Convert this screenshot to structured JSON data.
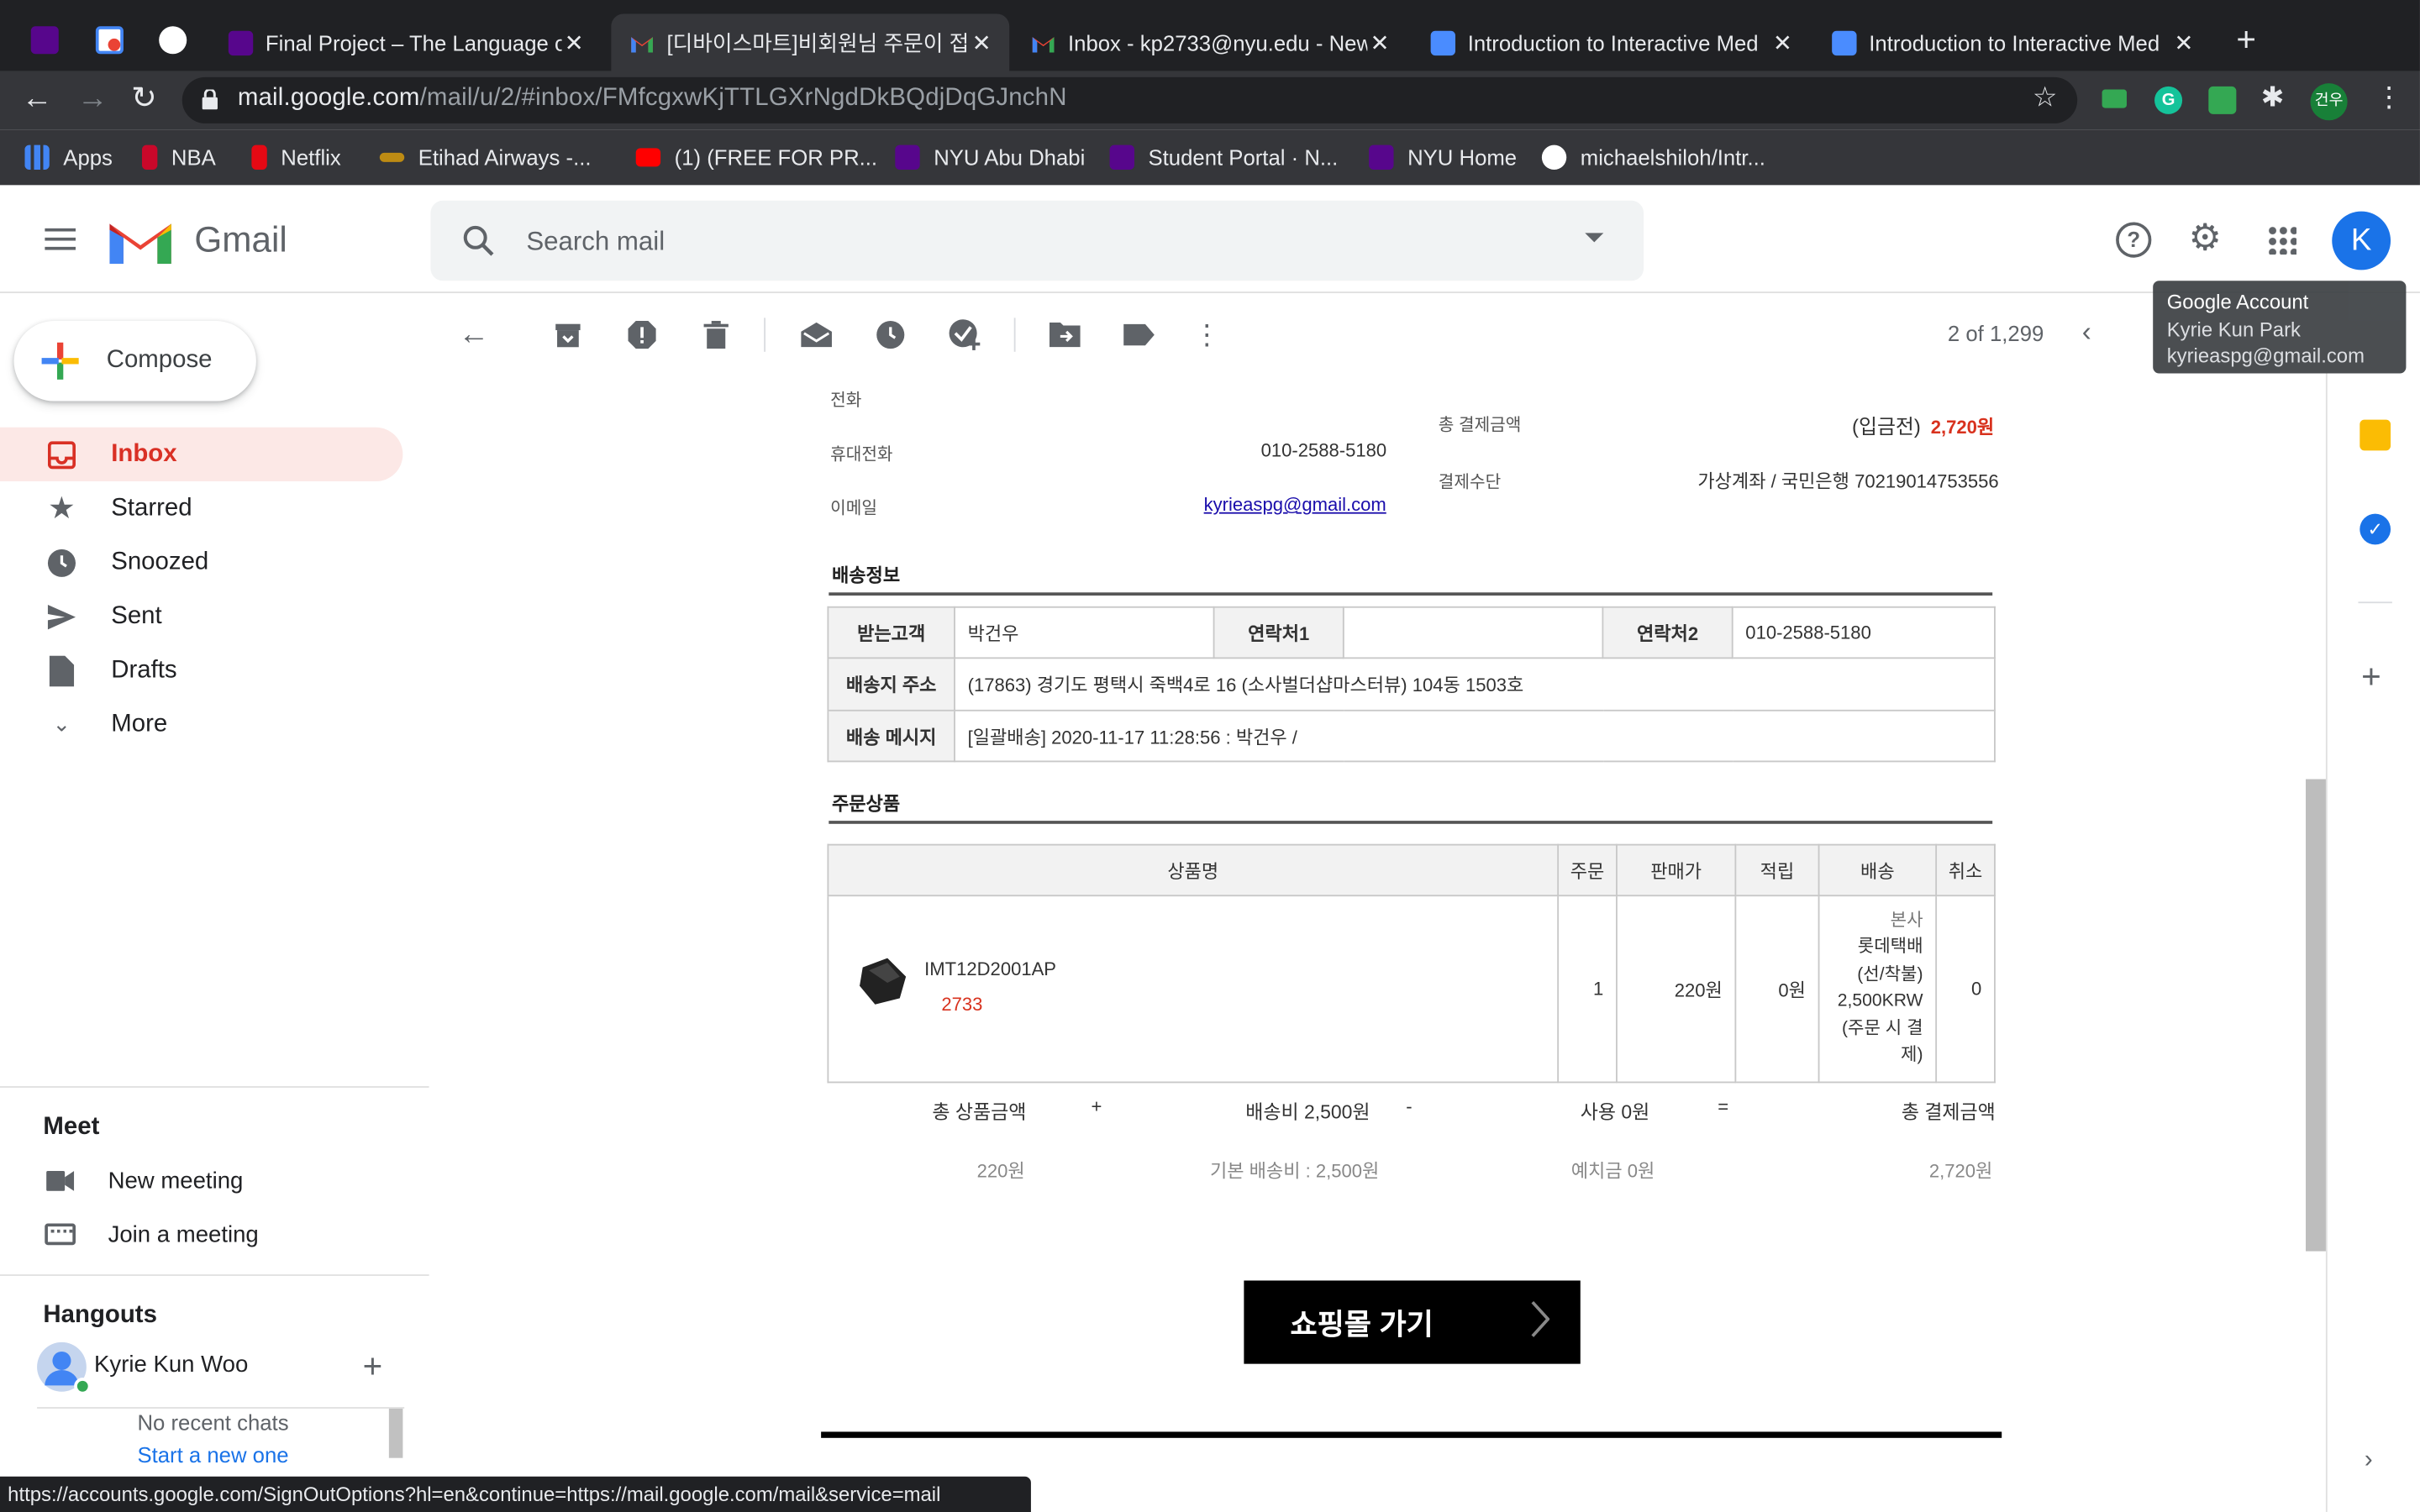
{
  "browser": {
    "tabs": [
      {
        "title": "Final Project – The Language o",
        "active": false
      },
      {
        "title": "[디바이스마트]비회원님 주문이 접수",
        "active": true
      },
      {
        "title": "Inbox - kp2733@nyu.edu - New",
        "active": false
      },
      {
        "title": "Introduction to Interactive Med",
        "active": false
      },
      {
        "title": "Introduction to Interactive Med",
        "active": false
      }
    ],
    "url_host": "mail.google.com",
    "url_path": "/mail/u/2/#inbox/FMfcgxwKjTTLGXrNgdDkBQdjDqGJnchN",
    "profile_badge": "건우",
    "bookmarks": [
      "Apps",
      "NBA",
      "Netflix",
      "Etihad Airways -...",
      "(1) (FREE FOR PR...",
      "NYU Abu Dhabi",
      "Student Portal · N...",
      "NYU Home",
      "michaelshiloh/Intr..."
    ]
  },
  "gmail": {
    "logo_text": "Gmail",
    "search_placeholder": "Search mail",
    "avatar_letter": "K",
    "compose": "Compose",
    "nav": [
      "Inbox",
      "Starred",
      "Snoozed",
      "Sent",
      "Drafts",
      "More"
    ],
    "meet_title": "Meet",
    "meet_items": [
      "New meeting",
      "Join a meeting"
    ],
    "hangouts_title": "Hangouts",
    "hangouts_user": "Kyrie Kun Woo",
    "no_chats": "No recent chats",
    "start_new": "Start a new one",
    "pagination": "2 of 1,299",
    "tooltip": {
      "title": "Google Account",
      "name": "Kyrie Kun Park",
      "email": "kyrieaspg@gmail.com"
    },
    "status_url": "https://accounts.google.com/SignOutOptions?hl=en&continue=https://mail.google.com/mail&service=mail"
  },
  "email": {
    "phone_label": "전화",
    "mobile_label": "휴대전화",
    "mobile_value": "010-2588-5180",
    "email_label": "이메일",
    "email_value": "kyrieaspg@gmail.com",
    "total_label": "총 결제금액",
    "total_prefix": "(입금전)",
    "total_value": "2,720원",
    "payment_label": "결제수단",
    "payment_value": "가상계좌 / 국민은행 70219014753556",
    "shipping_title": "배송정보",
    "receiver_label": "받는고객",
    "receiver_value": "박건우",
    "contact1_label": "연락처1",
    "contact1_value": "",
    "contact2_label": "연락처2",
    "contact2_value": "010-2588-5180",
    "address_label": "배송지 주소",
    "address_value": "(17863) 경기도 평택시 죽백4로 16 (소사벌더샵마스터뷰) 104동 1503호",
    "message_label": "배송 메시지",
    "message_value": "[일괄배송] 2020-11-17 11:28:56 : 박건우 /",
    "order_title": "주문상품",
    "cols": [
      "상품명",
      "주문",
      "판매가",
      "적립",
      "배송",
      "취소"
    ],
    "product": {
      "name": "IMT12D2001AP",
      "option": "2733",
      "qty": "1",
      "price": "220원",
      "points": "0원",
      "ship": [
        "본사",
        "롯데택배",
        "(선/착불)",
        "2,500KRW",
        "(주문 시 결",
        "제)"
      ],
      "cancel": "0"
    },
    "summary": {
      "goods_label": "총 상품금액",
      "plus": "+",
      "ship_label": "배송비 2,500원",
      "minus": "-",
      "use_label": "사용 0원",
      "eq": "=",
      "total_label": "총 결제금액",
      "goods_value": "220원",
      "ship_base": "기본 배송비 : 2,500원",
      "deposit": "예치금 0원",
      "total_value": "2,720원"
    },
    "shop_button": "쇼핑몰 가기"
  }
}
